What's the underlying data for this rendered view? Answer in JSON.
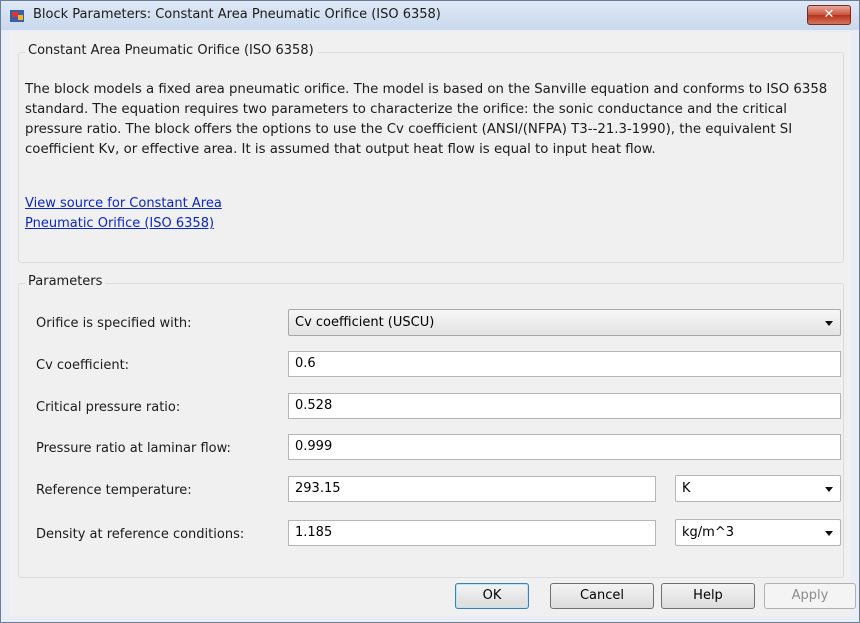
{
  "window": {
    "title": "Block Parameters: Constant Area Pneumatic Orifice (ISO 6358)",
    "close_label": "✕"
  },
  "block": {
    "name": "Constant Area Pneumatic Orifice (ISO 6358)",
    "description": "The block models a fixed area pneumatic orifice. The model is based on the Sanville equation and conforms to ISO 6358 standard. The equation requires two parameters to characterize the orifice: the sonic conductance and the critical pressure ratio. The block offers the options to use the Cv coefficient (ANSI/(NFPA) T3--21.3-1990), the equivalent SI coefficient Kv, or effective area. It is assumed that output heat flow is equal to input heat flow.",
    "source_link": "View source for Constant Area Pneumatic Orifice (ISO 6358)"
  },
  "parameters": {
    "group_label": "Parameters",
    "orifice_spec": {
      "label": "Orifice is specified with:",
      "value": "Cv coefficient (USCU)"
    },
    "cv": {
      "label": "Cv coefficient:",
      "value": "0.6"
    },
    "crit_ratio": {
      "label": "Critical pressure ratio:",
      "value": "0.528"
    },
    "laminar_ratio": {
      "label": "Pressure ratio at laminar flow:",
      "value": "0.999"
    },
    "ref_temp": {
      "label": "Reference temperature:",
      "value": "293.15",
      "unit": "K"
    },
    "ref_density": {
      "label": "Density at reference conditions:",
      "value": "1.185",
      "unit": "kg/m^3"
    }
  },
  "buttons": {
    "ok": "OK",
    "cancel": "Cancel",
    "help": "Help",
    "apply": "Apply"
  },
  "icons": {
    "title_icon": "simulink-block-icon",
    "dropdown": "chevron-down-icon"
  }
}
